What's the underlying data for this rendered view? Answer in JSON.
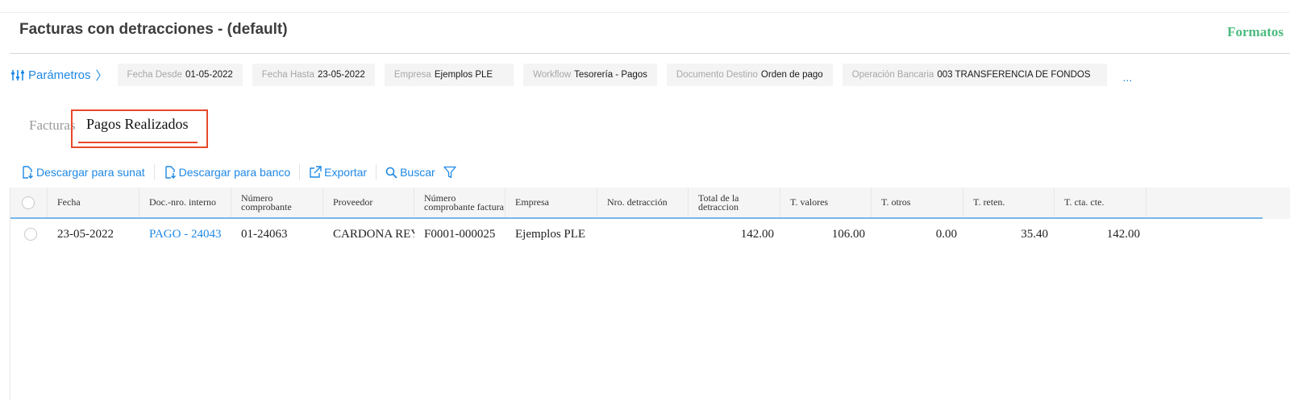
{
  "page": {
    "title": "Facturas con detracciones - (default)",
    "formatos_label": "Formatos"
  },
  "params": {
    "label": "Parámetros",
    "chevron": "〉",
    "more": "...",
    "chips": [
      {
        "label": "Fecha Desde",
        "value": "01-05-2022"
      },
      {
        "label": "Fecha Hasta",
        "value": "23-05-2022"
      },
      {
        "label": "Empresa",
        "value": "Ejemplos PLE"
      },
      {
        "label": "Workflow",
        "value": "Tesorería - Pagos"
      },
      {
        "label": "Documento Destino",
        "value": "Orden de pago"
      },
      {
        "label": "Operación Bancaria",
        "value": "003 TRANSFERENCIA DE FONDOS"
      }
    ]
  },
  "tabs": {
    "facturas": "Facturas",
    "pagos": "Pagos Realizados"
  },
  "toolbar": {
    "descargar_sunat": "Descargar para sunat",
    "descargar_banco": "Descargar para banco",
    "exportar": "Exportar",
    "buscar": "Buscar"
  },
  "table": {
    "columns": [
      "Fecha",
      "Doc.-nro. interno",
      "Número comprobante",
      "Proveedor",
      "Número comprobante factura",
      "Empresa",
      "Nro. detracción",
      "Total de la detraccion",
      "T. valores",
      "T. otros",
      "T. reten.",
      "T. cta. cte."
    ],
    "rows": [
      {
        "fecha": "23-05-2022",
        "doc_interno": "PAGO - 24043",
        "comprobante": "01-24063",
        "proveedor": "CARDONA REYES",
        "comprobante_factura": "F0001-000025",
        "empresa": "Ejemplos PLE",
        "nro_detraccion": "",
        "total_detraccion": "142.00",
        "t_valores": "106.00",
        "t_otros": "0.00",
        "t_reten": "35.40",
        "t_cta_cte": "142.00"
      }
    ]
  },
  "colors": {
    "accent_blue": "#1e88e5",
    "formatos_green": "#4cbb7f",
    "highlight_red": "#e8492a"
  }
}
